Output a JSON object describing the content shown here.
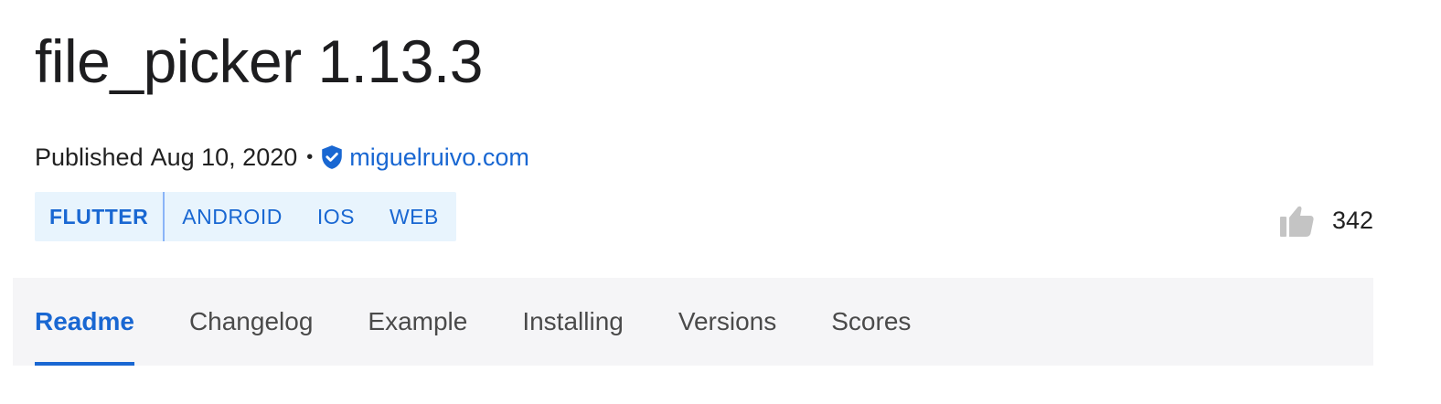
{
  "package": {
    "name": "file_picker",
    "version": "1.13.3",
    "title": "file_picker 1.13.3"
  },
  "meta": {
    "published_label": "Published",
    "published_date": "Aug 10, 2020",
    "separator": "•",
    "verified_icon": "verified-publisher-shield-icon",
    "publisher": "miguelruivo.com"
  },
  "platforms": {
    "sdk": "FLUTTER",
    "items": [
      "ANDROID",
      "IOS",
      "WEB"
    ]
  },
  "likes": {
    "icon": "thumbs-up-icon",
    "count": "342"
  },
  "tabs": {
    "items": [
      "Readme",
      "Changelog",
      "Example",
      "Installing",
      "Versions",
      "Scores"
    ],
    "active": "Readme"
  },
  "colors": {
    "accent": "#1967d2",
    "platform_bg": "#e8f4fd",
    "tabbar_bg": "#f5f5f7",
    "thumb_icon": "#c4c4c4"
  }
}
